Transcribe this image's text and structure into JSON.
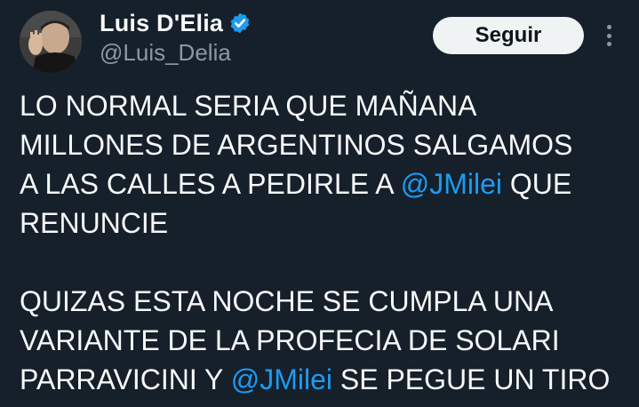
{
  "tweet": {
    "author": {
      "display_name": "Luis D'Elia",
      "handle": "@Luis_Delia",
      "verified": true
    },
    "follow_label": "Seguir",
    "more_icon": "more-vertical-icon",
    "text": {
      "paragraph_1": {
        "line_1": "LO NORMAL SERIA QUE MAÑANA",
        "line_2": "MILLONES DE ARGENTINOS SALGAMOS",
        "line_3_before": "A LAS CALLES A PEDIRLE A ",
        "line_3_mention": "@JMilei",
        "line_3_after": " QUE",
        "line_4": "RENUNCIE"
      },
      "paragraph_2": {
        "line_1": "QUIZAS ESTA NOCHE SE CUMPLA UNA",
        "line_2": "VARIANTE DE LA PROFECIA DE SOLARI",
        "line_3_before": "PARRAVICINI Y ",
        "line_3_mention": "@JMilei",
        "line_3_after": " SE PEGUE UN TIRO"
      }
    }
  },
  "colors": {
    "background": "#15202b",
    "text": "#f7f9f9",
    "secondary_text": "#8b98a5",
    "mention": "#1d9bf0",
    "verified_badge": "#1d9bf0",
    "button_bg": "#eff3f4"
  }
}
